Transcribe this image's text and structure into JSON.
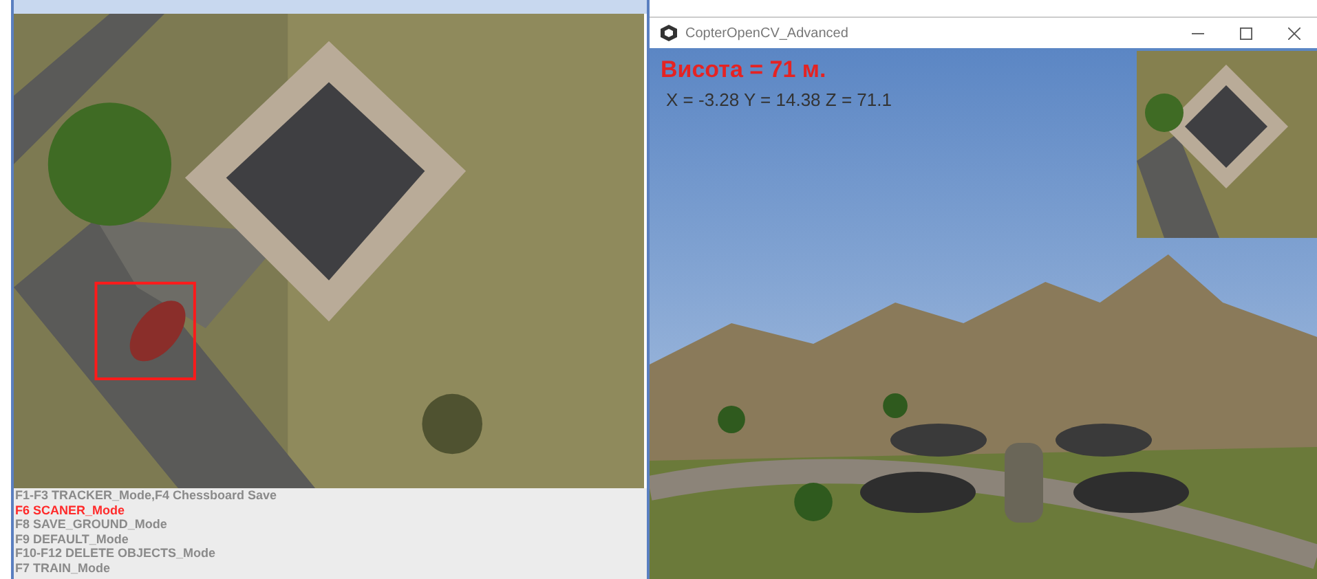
{
  "tracker_window": {
    "modes": [
      {
        "label": "F1-F3 TRACKER_Mode,F4 Chessboard Save",
        "selected": false
      },
      {
        "label": "F6 SCANER_Mode",
        "selected": true
      },
      {
        "label": "F8 SAVE_GROUND_Mode",
        "selected": false
      },
      {
        "label": "F9 DEFAULT_Mode",
        "selected": false
      },
      {
        "label": "F10-F12 DELETE OBJECTS_Mode",
        "selected": false
      },
      {
        "label": "F7 TRAIN_Mode",
        "selected": false
      }
    ]
  },
  "sim_window": {
    "title": "CopterOpenCV_Advanced",
    "altitude": "Висота = 71 м.",
    "coordinates": "X = -3.28 Y = 14.38 Z = 71.1"
  }
}
